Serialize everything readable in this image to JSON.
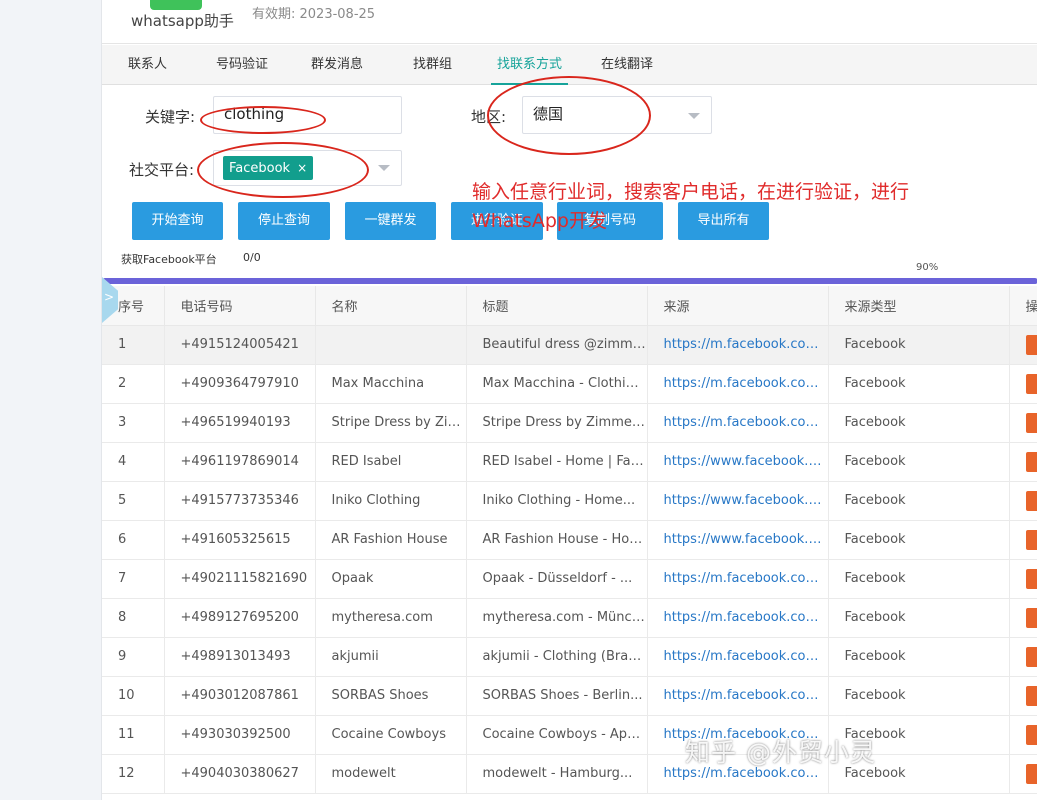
{
  "app": {
    "name": "whatsapp助手",
    "validity": "有效期: 2023-08-25"
  },
  "tabs": [
    {
      "label": "联系人"
    },
    {
      "label": "号码验证"
    },
    {
      "label": "群发消息"
    },
    {
      "label": "找群组"
    },
    {
      "label": "找联系方式",
      "active": true
    },
    {
      "label": "在线翻译"
    }
  ],
  "form": {
    "keyword_label": "关键字:",
    "keyword_value": "clothing",
    "region_label": "地区:",
    "region_value": "德国",
    "platform_label": "社交平台:",
    "platform_tag": "Facebook",
    "tag_close": "×"
  },
  "buttons": [
    "开始查询",
    "停止查询",
    "一键群发",
    "进行验证",
    "复制号码",
    "导出所有"
  ],
  "annotation": "输入任意行业词，搜索客户电话，在进行验证，进行WhatsApp开发",
  "progress": {
    "label": "获取Facebook平台",
    "count": "0/0",
    "percent": 90,
    "percent_text": "90%"
  },
  "side_tab": ">",
  "table": {
    "headers": [
      "序号",
      "电话号码",
      "名称",
      "标题",
      "来源",
      "来源类型",
      "操"
    ],
    "rows": [
      [
        "1",
        "+4915124005421",
        "",
        "Beautiful dress @zimmermann...",
        "https://m.facebook.com/...",
        "Facebook"
      ],
      [
        "2",
        "+4909364797910",
        "Max Macchina",
        "Max Macchina - Clothing...",
        "https://m.facebook.com/...",
        "Facebook"
      ],
      [
        "3",
        "+496519940193",
        "Stripe Dress by Zimmermann",
        "Stripe Dress by Zimmermann...",
        "https://m.facebook.com/...",
        "Facebook"
      ],
      [
        "4",
        "+4961197869014",
        "RED Isabel",
        "RED Isabel - Home | Facebook",
        "https://www.facebook.com/...",
        "Facebook"
      ],
      [
        "5",
        "+4915773735346",
        "Iniko Clothing",
        "Iniko Clothing - Home...",
        "https://www.facebook.com/...",
        "Facebook"
      ],
      [
        "6",
        "+491605325615",
        "AR Fashion House",
        "AR Fashion House - Home...",
        "https://www.facebook.com/...",
        "Facebook"
      ],
      [
        "7",
        "+49021115821690",
        "Opaak",
        "Opaak - Düsseldorf - ...",
        "https://m.facebook.com/...",
        "Facebook"
      ],
      [
        "8",
        "+4989127695200",
        "mytheresa.com",
        "mytheresa.com - München...",
        "https://m.facebook.com/...",
        "Facebook"
      ],
      [
        "9",
        "+498913013493",
        "akjumii",
        "akjumii - Clothing (Brand)...",
        "https://m.facebook.com/...",
        "Facebook"
      ],
      [
        "10",
        "+4903012087861",
        "SORBAS Shoes",
        "SORBAS Shoes - Berlin...",
        "https://m.facebook.com/...",
        "Facebook"
      ],
      [
        "11",
        "+493030392500",
        "Cocaine Cowboys",
        "Cocaine Cowboys - Apparel...",
        "https://m.facebook.com/...",
        "Facebook"
      ],
      [
        "12",
        "+4904030380627",
        "modewelt",
        "modewelt - Hamburg...",
        "https://m.facebook.com/...",
        "Facebook"
      ]
    ]
  },
  "watermark": "知乎 @外贸小灵",
  "colors": {
    "accent": "#16a39a",
    "button": "#2a9be0",
    "progress": "#6b63d9",
    "annotation": "#e02b2b",
    "link": "#2777c6"
  }
}
